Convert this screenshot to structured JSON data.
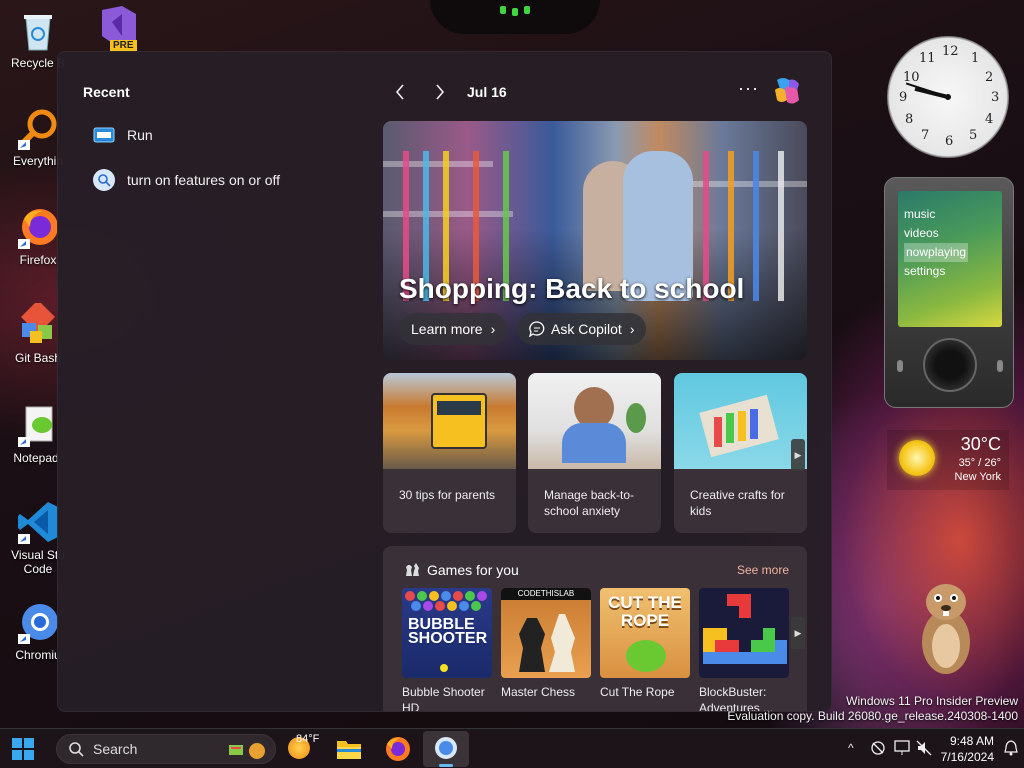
{
  "desktop": {
    "icons": [
      {
        "label": "Recycle B",
        "icon": "recycle-bin-icon"
      },
      {
        "label": "Everythin",
        "icon": "everything-search-icon"
      },
      {
        "label": "Firefox",
        "icon": "firefox-icon"
      },
      {
        "label": "Git Bash",
        "icon": "git-bash-icon"
      },
      {
        "label": "Notepad-",
        "icon": "notepad-plus-icon"
      },
      {
        "label": "Visual Stu",
        "label2": "Code",
        "icon": "vscode-icon"
      },
      {
        "label": "Chromiu",
        "icon": "chromium-icon"
      }
    ],
    "vs_badge": "PRE"
  },
  "widgets": {
    "recent_title": "Recent",
    "recent_items": [
      {
        "label": "Run",
        "icon": "run-icon"
      },
      {
        "label": "turn on features on or off",
        "icon": "search-icon"
      }
    ],
    "date": "Jul 16",
    "more": "···",
    "hero": {
      "title": "Shopping: Back to school",
      "learn_more": "Learn more",
      "ask_copilot": "Ask Copilot"
    },
    "cards": [
      {
        "caption": "30 tips for parents"
      },
      {
        "caption": "Manage back-to-school anxiety"
      },
      {
        "caption": "Creative crafts for kids"
      }
    ],
    "games": {
      "title": "Games for you",
      "see_more": "See more",
      "items": [
        {
          "name": "Bubble Shooter HD",
          "art_text": "BUBBLE SHOOTER"
        },
        {
          "name": "Master Chess",
          "art_text": "CODETHISLAB"
        },
        {
          "name": "Cut The Rope",
          "art_text": "CUT THE ROPE"
        },
        {
          "name": "BlockBuster: Adventures ..."
        }
      ]
    }
  },
  "gadgets": {
    "zune_menu": [
      "music",
      "videos",
      "nowplaying",
      "settings"
    ],
    "zune_selected": "nowplaying",
    "weather": {
      "temp": "30°C",
      "range": "35° / 26°",
      "city": "New York"
    },
    "clock_numbers": [
      "12",
      "1",
      "2",
      "3",
      "4",
      "5",
      "6",
      "7",
      "8",
      "9",
      "10",
      "11"
    ]
  },
  "watermark": {
    "line1": "Windows 11 Pro Insider Preview",
    "line2": "Evaluation copy. Build 26080.ge_release.240308-1400"
  },
  "taskbar": {
    "search_placeholder": "Search",
    "weather_temp": "84°F",
    "time": "9:48 AM",
    "date": "7/16/2024",
    "tray_chevron": "^"
  },
  "colors": {
    "accent_link": "#f0b4a0",
    "panel_bg": "#261e26",
    "card_bg": "#3a3038"
  }
}
